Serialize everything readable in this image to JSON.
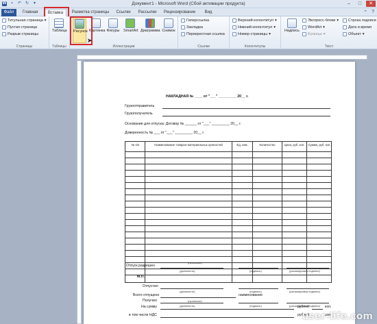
{
  "window": {
    "title": "Документ1 - Microsoft Word (Сбой активации продукта)"
  },
  "tabs": [
    "Файл",
    "Главная",
    "Вставка",
    "Разметка страницы",
    "Ссылки",
    "Рассылки",
    "Рецензирование",
    "Вид"
  ],
  "ribbon": {
    "pages": {
      "items": [
        "Титульная страница",
        "Пустая страница",
        "Разрыв страницы"
      ],
      "label": "Страницы"
    },
    "tables": {
      "button": "Таблица",
      "label": "Таблицы"
    },
    "illustrations": {
      "buttons": [
        "Рисунок",
        "Картинка",
        "Фигуры",
        "SmartArt",
        "Диаграмма",
        "Снимок"
      ],
      "label": "Иллюстрации"
    },
    "links": {
      "items": [
        "Гиперссылка",
        "Закладка",
        "Перекрестная ссылка"
      ],
      "label": "Ссылки"
    },
    "headers": {
      "items": [
        "Верхний колонтитул",
        "Нижний колонтитул",
        "Номер страницы"
      ],
      "label": "Колонтитулы"
    },
    "text": {
      "big": "Надпись",
      "items": [
        "Экспресс-блоки",
        "WordArt",
        "Буквица"
      ],
      "right_items": [
        "Строка подписи",
        "Дата и время",
        "Объект"
      ],
      "label": "Текст"
    }
  },
  "document": {
    "title_line": "НАКЛАДНАЯ   № ____ от \"___\" _________ 20__ г.",
    "shipper": "Грузоотправитель",
    "consignee": "Грузополучатель",
    "basis": "Основание для отпуска: Договор № ______ от \"___\" _________ 20__ г.",
    "proxy": "Доверенность № ___ от \"___\" _________ 20__ г.",
    "table_headers": [
      "№ п/п",
      "Наименование товарно-материальных ценностей",
      "Ед. изм.",
      "Количество",
      "Цена, руб. коп.",
      "Сумма, руб. коп."
    ],
    "released": "Всего отпущено",
    "naming": "наименование",
    "in_words": "(прописью)",
    "sum": "На сумму",
    "vat": "в том числе НДС",
    "rub": "рублей",
    "kop": "коп.",
    "allowed": "Отпуск разрешен",
    "position": "(должность)",
    "signature": "(подпись)",
    "decoding": "(расшифровка подписи)",
    "mp": "М.П.",
    "released_by": "Отпустил",
    "received_by": "Получил"
  },
  "watermark": "user-life.com"
}
